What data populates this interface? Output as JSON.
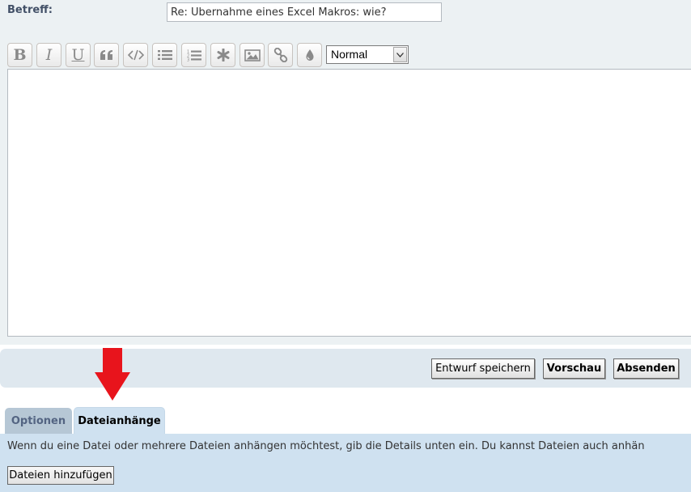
{
  "subject": {
    "label": "Betreff:",
    "value": "Re: Übernahme eines Excel Makros: wie?"
  },
  "toolbar": {
    "buttons": [
      {
        "name": "bold",
        "glyph": "B",
        "icon": "bold-icon"
      },
      {
        "name": "italic",
        "glyph": "I",
        "icon": "italic-icon"
      },
      {
        "name": "underline",
        "glyph": "U",
        "icon": "underline-icon"
      },
      {
        "name": "quote",
        "icon": "quote-icon"
      },
      {
        "name": "code",
        "icon": "code-icon"
      },
      {
        "name": "list",
        "icon": "list-icon"
      },
      {
        "name": "numbered-list",
        "icon": "numbered-list-icon"
      },
      {
        "name": "list-item",
        "icon": "asterisk-icon"
      },
      {
        "name": "image",
        "icon": "image-icon"
      },
      {
        "name": "link",
        "icon": "link-icon"
      },
      {
        "name": "color",
        "icon": "color-drop-icon"
      }
    ],
    "font_size": {
      "selected": "Normal"
    }
  },
  "actions": {
    "save_draft": "Entwurf speichern",
    "preview": "Vorschau",
    "submit": "Absenden"
  },
  "tabs": {
    "options": "Optionen",
    "attachments": "Dateianhänge"
  },
  "attachments": {
    "info": "Wenn du eine Datei oder mehrere Dateien anhängen möchtest, gib die Details unten ein. Du kannst Dateien auch anhän",
    "add_button": "Dateien hinzufügen"
  },
  "colors": {
    "panel_bg": "#ecf1f3",
    "submit_bar_bg": "#dfe8ef",
    "tab_active_bg": "#cfe1f0",
    "tab_inactive_bg": "#b6c7d5",
    "annotation_arrow": "#e8141c"
  }
}
